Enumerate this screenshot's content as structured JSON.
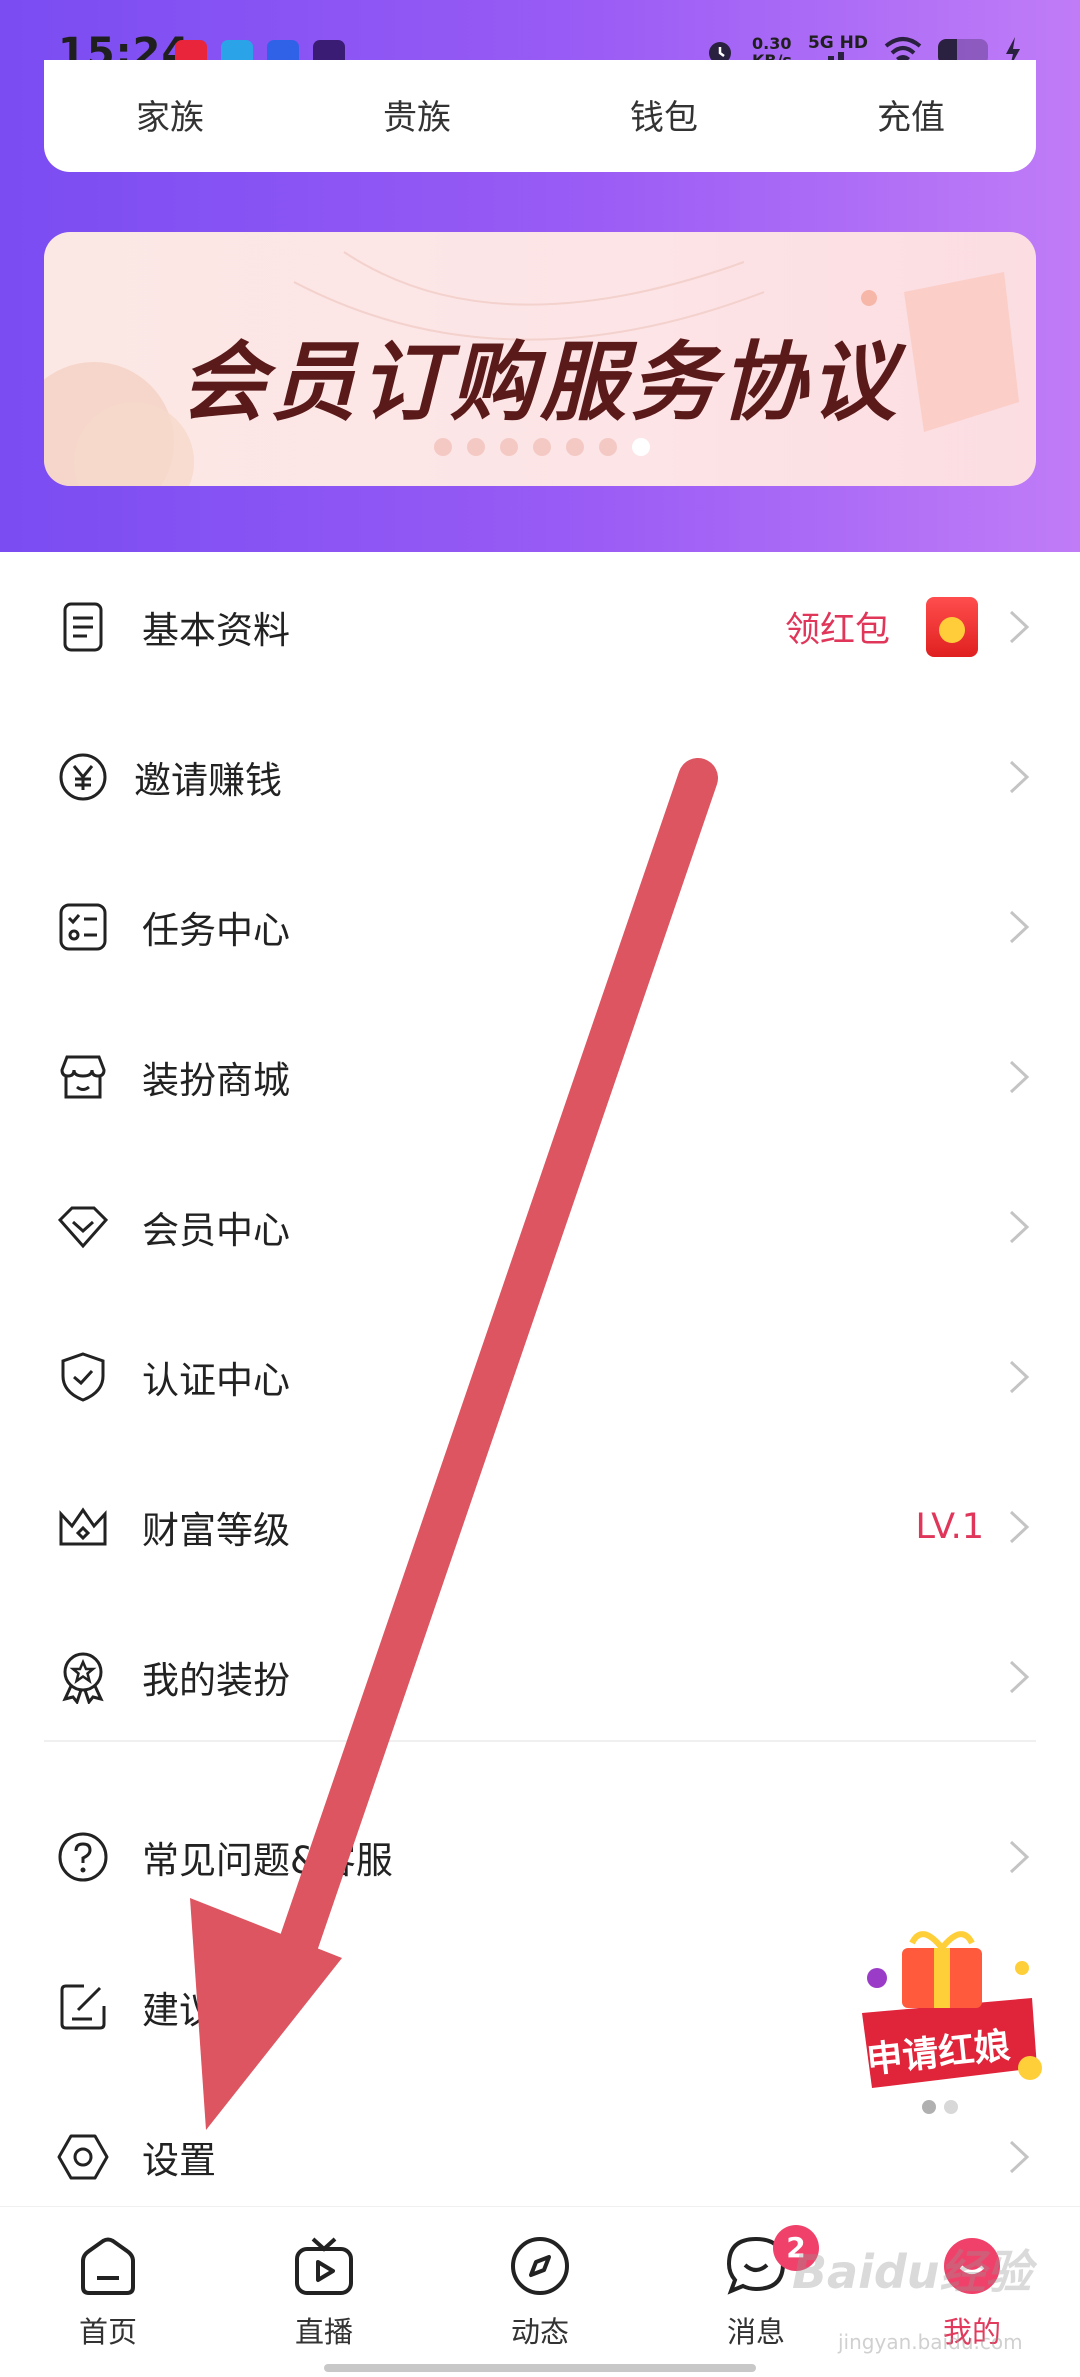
{
  "status_bar": {
    "time": "15:24",
    "speed_value": "0.30",
    "speed_unit": "KB/s",
    "network": "5G HD"
  },
  "quick_links": [
    "家族",
    "贵族",
    "钱包",
    "充值"
  ],
  "banner": {
    "title": "会员订购服务协议",
    "dot_count": 7,
    "active_dot": 6
  },
  "menu": {
    "items": [
      {
        "label": "基本资料",
        "extra": "领红包",
        "icon": "profile-doc-icon"
      },
      {
        "label": "邀请赚钱",
        "icon": "yen-circle-icon"
      },
      {
        "label": "任务中心",
        "icon": "checklist-icon"
      },
      {
        "label": "装扮商城",
        "icon": "shop-icon"
      },
      {
        "label": "会员中心",
        "icon": "diamond-icon"
      },
      {
        "label": "认证中心",
        "icon": "shield-check-icon"
      },
      {
        "label": "财富等级",
        "extra": "LV.1",
        "icon": "crown-icon"
      },
      {
        "label": "我的装扮",
        "icon": "badge-star-icon"
      },
      {
        "label": "常见问题&客服",
        "icon": "question-circle-icon"
      },
      {
        "label": "建议反馈",
        "icon": "edit-square-icon"
      },
      {
        "label": "设置",
        "icon": "settings-hexagon-icon"
      }
    ]
  },
  "promo": {
    "label": "申请红娘"
  },
  "bottom_nav": {
    "items": [
      {
        "label": "首页",
        "icon": "home-icon"
      },
      {
        "label": "直播",
        "icon": "tv-play-icon"
      },
      {
        "label": "动态",
        "icon": "compass-icon"
      },
      {
        "label": "消息",
        "icon": "chat-bubble-icon",
        "badge": "2"
      },
      {
        "label": "我的",
        "icon": "profile-avatar-icon",
        "active": true
      }
    ]
  },
  "watermark": {
    "text": "Baidu经验",
    "sub": "jingyan.baidu.com"
  },
  "colors": {
    "header_gradient_start": "#7a4cf2",
    "header_gradient_end": "#c07cf7",
    "accent_red": "#e0365a",
    "arrow": "#dc5560"
  }
}
